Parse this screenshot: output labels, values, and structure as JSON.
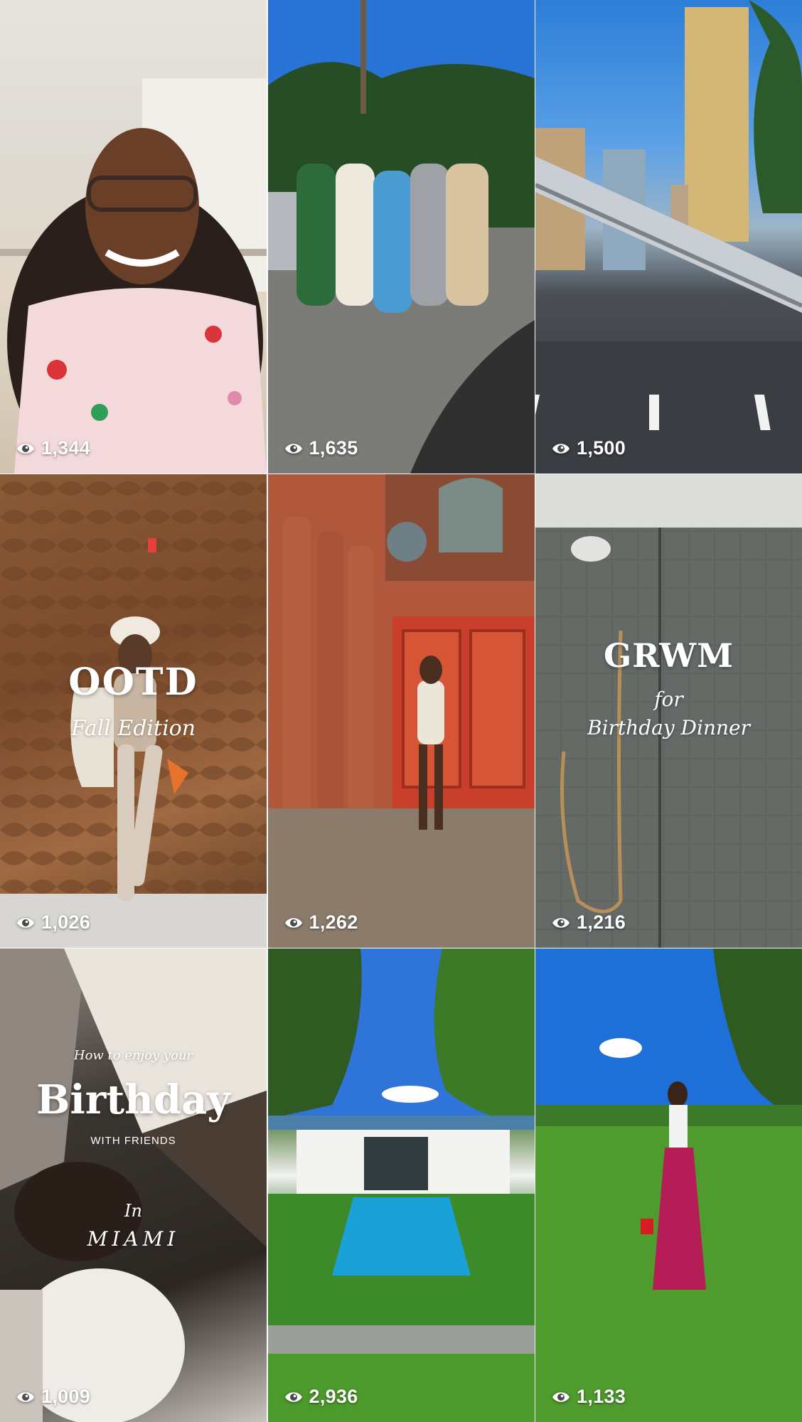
{
  "tiles": [
    {
      "views": "1,344"
    },
    {
      "views": "1,635"
    },
    {
      "views": "1,500"
    },
    {
      "views": "1,026",
      "title": "OOTD",
      "subtitle": "Fall Edition"
    },
    {
      "views": "1,262"
    },
    {
      "views": "1,216",
      "title": "GRWM",
      "subtitle_1": "for",
      "subtitle_2": "Birthday Dinner"
    },
    {
      "views": "1,009",
      "kicker": "How to enjoy your",
      "title": "Birthday",
      "subtitle": "WITH FRIENDS",
      "script_1": "In",
      "script_2": "MIAMI"
    },
    {
      "views": "2,936"
    },
    {
      "views": "1,133"
    }
  ],
  "icons": {
    "views": "eye-icon"
  }
}
